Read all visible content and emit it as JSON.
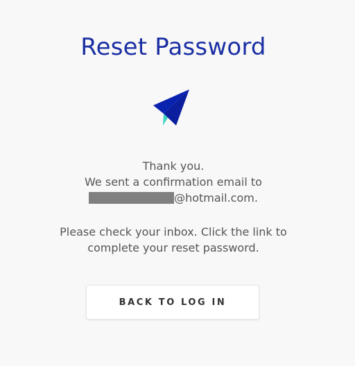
{
  "page": {
    "title": "Reset Password",
    "icon": "paper-plane-icon"
  },
  "message": {
    "thanks": "Thank you.",
    "sent": "We sent a confirmation email to",
    "email_suffix": "@hotmail.com.",
    "instructions": "Please check your inbox. Click the link to complete your reset password."
  },
  "actions": {
    "back_label": "BACK TO LOG IN"
  },
  "colors": {
    "title": "#1b2fa3",
    "plane": "#0a22b0",
    "plane_accent": "#3fd3c2",
    "redaction": "#808080"
  }
}
